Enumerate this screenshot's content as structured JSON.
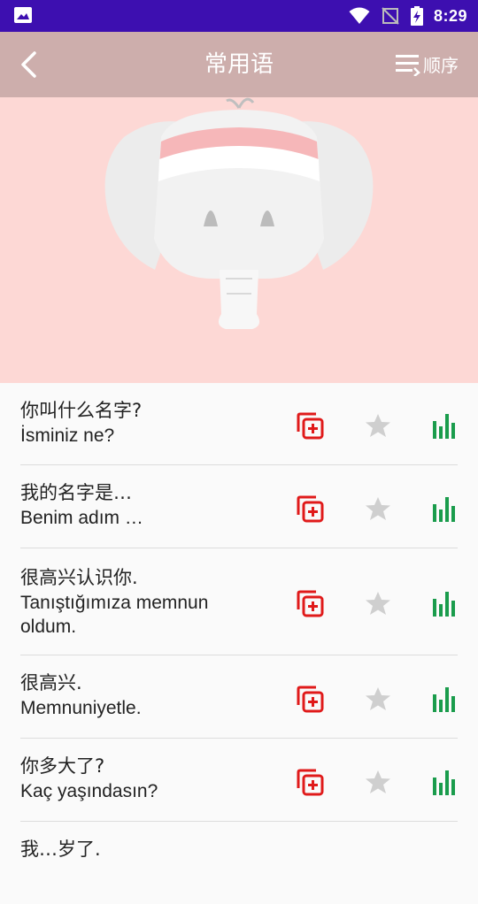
{
  "status_bar": {
    "time": "8:29"
  },
  "header": {
    "title": "常用语",
    "sort_label": "顺序"
  },
  "colors": {
    "status_bar": "#3d0fb0",
    "app_bar": "#cdaeac",
    "hero_bg": "#fdd8d5",
    "add_icon": "#e01a1a",
    "star_icon": "#cfcfcf",
    "stats_icon": "#1a9c4c"
  },
  "phrases": [
    {
      "zh": "你叫什么名字?",
      "tr": "İsminiz ne?"
    },
    {
      "zh": "我的名字是…",
      "tr": "Benim adım …"
    },
    {
      "zh": "很高兴认识你.",
      "tr": "Tanıştığımıza memnun oldum."
    },
    {
      "zh": "很高兴.",
      "tr": "Memnuniyetle."
    },
    {
      "zh": "你多大了?",
      "tr": "Kaç yaşındasın?"
    },
    {
      "zh": "我…岁了.",
      "tr": ""
    }
  ]
}
